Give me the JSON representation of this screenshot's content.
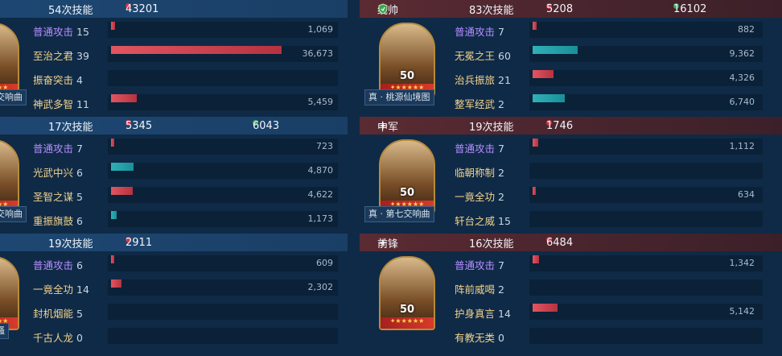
{
  "left_panel": {
    "blocks": [
      {
        "header": {
          "skill_count": "54次技能",
          "stat_red": "43201"
        },
        "portrait": {
          "level": "",
          "tag": "交响曲"
        },
        "rows": [
          {
            "skill": "普通攻击",
            "count": "15",
            "type": "purple",
            "bar_color": "red",
            "fraction": 0.025,
            "value": "1,069"
          },
          {
            "skill": "至治之君",
            "count": "39",
            "type": "gold",
            "bar_color": "red",
            "fraction": 1.0,
            "value": "36,673"
          },
          {
            "skill": "振奋突击",
            "count": "4",
            "type": "gold",
            "bar_color": "",
            "fraction": 0,
            "value": ""
          },
          {
            "skill": "神武多智",
            "count": "11",
            "type": "gold",
            "bar_color": "red",
            "fraction": 0.15,
            "value": "5,459"
          }
        ]
      },
      {
        "header": {
          "skill_count": "17次技能",
          "stat_red": "5345",
          "stat_green": "6043"
        },
        "portrait": {
          "level": "",
          "tag": "交响曲"
        },
        "rows": [
          {
            "skill": "普通攻击",
            "count": "7",
            "type": "purple",
            "bar_color": "red",
            "fraction": 0.02,
            "value": "723"
          },
          {
            "skill": "光武中兴",
            "count": "6",
            "type": "gold",
            "bar_color": "teal",
            "fraction": 0.13,
            "value": "4,870"
          },
          {
            "skill": "圣智之谋",
            "count": "5",
            "type": "gold",
            "bar_color": "red",
            "fraction": 0.126,
            "value": "4,622"
          },
          {
            "skill": "重振旗鼓",
            "count": "6",
            "type": "gold",
            "bar_color": "teal",
            "fraction": 0.032,
            "value": "1,173"
          }
        ]
      },
      {
        "header": {
          "skill_count": "19次技能",
          "stat_red": "2911"
        },
        "portrait": {
          "level": "",
          "tag": "骚"
        },
        "rows": [
          {
            "skill": "普通攻击",
            "count": "6",
            "type": "purple",
            "bar_color": "red",
            "fraction": 0.017,
            "value": "609"
          },
          {
            "skill": "一竟全功",
            "count": "14",
            "type": "gold",
            "bar_color": "red",
            "fraction": 0.063,
            "value": "2,302"
          },
          {
            "skill": "封机烟能",
            "count": "5",
            "type": "gold",
            "bar_color": "",
            "fraction": 0,
            "value": ""
          },
          {
            "skill": "千古人龙",
            "count": "0",
            "type": "gold",
            "bar_color": "",
            "fraction": 0,
            "value": ""
          }
        ]
      }
    ]
  },
  "right_panel": {
    "blocks": [
      {
        "header": {
          "role": "统帅",
          "role_icon": "shield-icon",
          "skill_count": "83次技能",
          "stat_red": "5208",
          "stat_green": "16102"
        },
        "portrait": {
          "level": "50",
          "tag": "真 · 桃源仙境图"
        },
        "rows": [
          {
            "skill": "普通攻击",
            "count": "7",
            "type": "purple",
            "bar_color": "red",
            "fraction": 0.09,
            "value": "882"
          },
          {
            "skill": "无冕之王",
            "count": "60",
            "type": "gold",
            "bar_color": "teal",
            "fraction": 1.0,
            "value": "9,362"
          },
          {
            "skill": "治兵振旅",
            "count": "21",
            "type": "gold",
            "bar_color": "red",
            "fraction": 0.46,
            "value": "4,326"
          },
          {
            "skill": "整军经武",
            "count": "2",
            "type": "gold",
            "bar_color": "teal",
            "fraction": 0.72,
            "value": "6,740"
          }
        ]
      },
      {
        "header": {
          "role": "中军",
          "role_icon": "sparkle-icon",
          "skill_count": "19次技能",
          "stat_red": "1746"
        },
        "portrait": {
          "level": "50",
          "tag": "真 · 第七交响曲"
        },
        "rows": [
          {
            "skill": "普通攻击",
            "count": "7",
            "type": "purple",
            "bar_color": "red",
            "fraction": 0.12,
            "value": "1,112"
          },
          {
            "skill": "临朝称制",
            "count": "2",
            "type": "gold",
            "bar_color": "",
            "fraction": 0,
            "value": ""
          },
          {
            "skill": "一竟全功",
            "count": "2",
            "type": "gold",
            "bar_color": "red",
            "fraction": 0.068,
            "value": "634"
          },
          {
            "skill": "轩台之威",
            "count": "15",
            "type": "gold",
            "bar_color": "",
            "fraction": 0,
            "value": ""
          }
        ]
      },
      {
        "header": {
          "role": "前锋",
          "role_icon": "sparkle-icon",
          "skill_count": "16次技能",
          "stat_red": "6484"
        },
        "portrait": {
          "level": "50",
          "tag": ""
        },
        "rows": [
          {
            "skill": "普通攻击",
            "count": "7",
            "type": "purple",
            "bar_color": "red",
            "fraction": 0.14,
            "value": "1,342"
          },
          {
            "skill": "阵前威喝",
            "count": "2",
            "type": "gold",
            "bar_color": "",
            "fraction": 0,
            "value": ""
          },
          {
            "skill": "护身真言",
            "count": "14",
            "type": "gold",
            "bar_color": "red",
            "fraction": 0.55,
            "value": "5,142"
          },
          {
            "skill": "有教无类",
            "count": "0",
            "type": "gold",
            "bar_color": "",
            "fraction": 0,
            "value": ""
          }
        ]
      }
    ]
  }
}
